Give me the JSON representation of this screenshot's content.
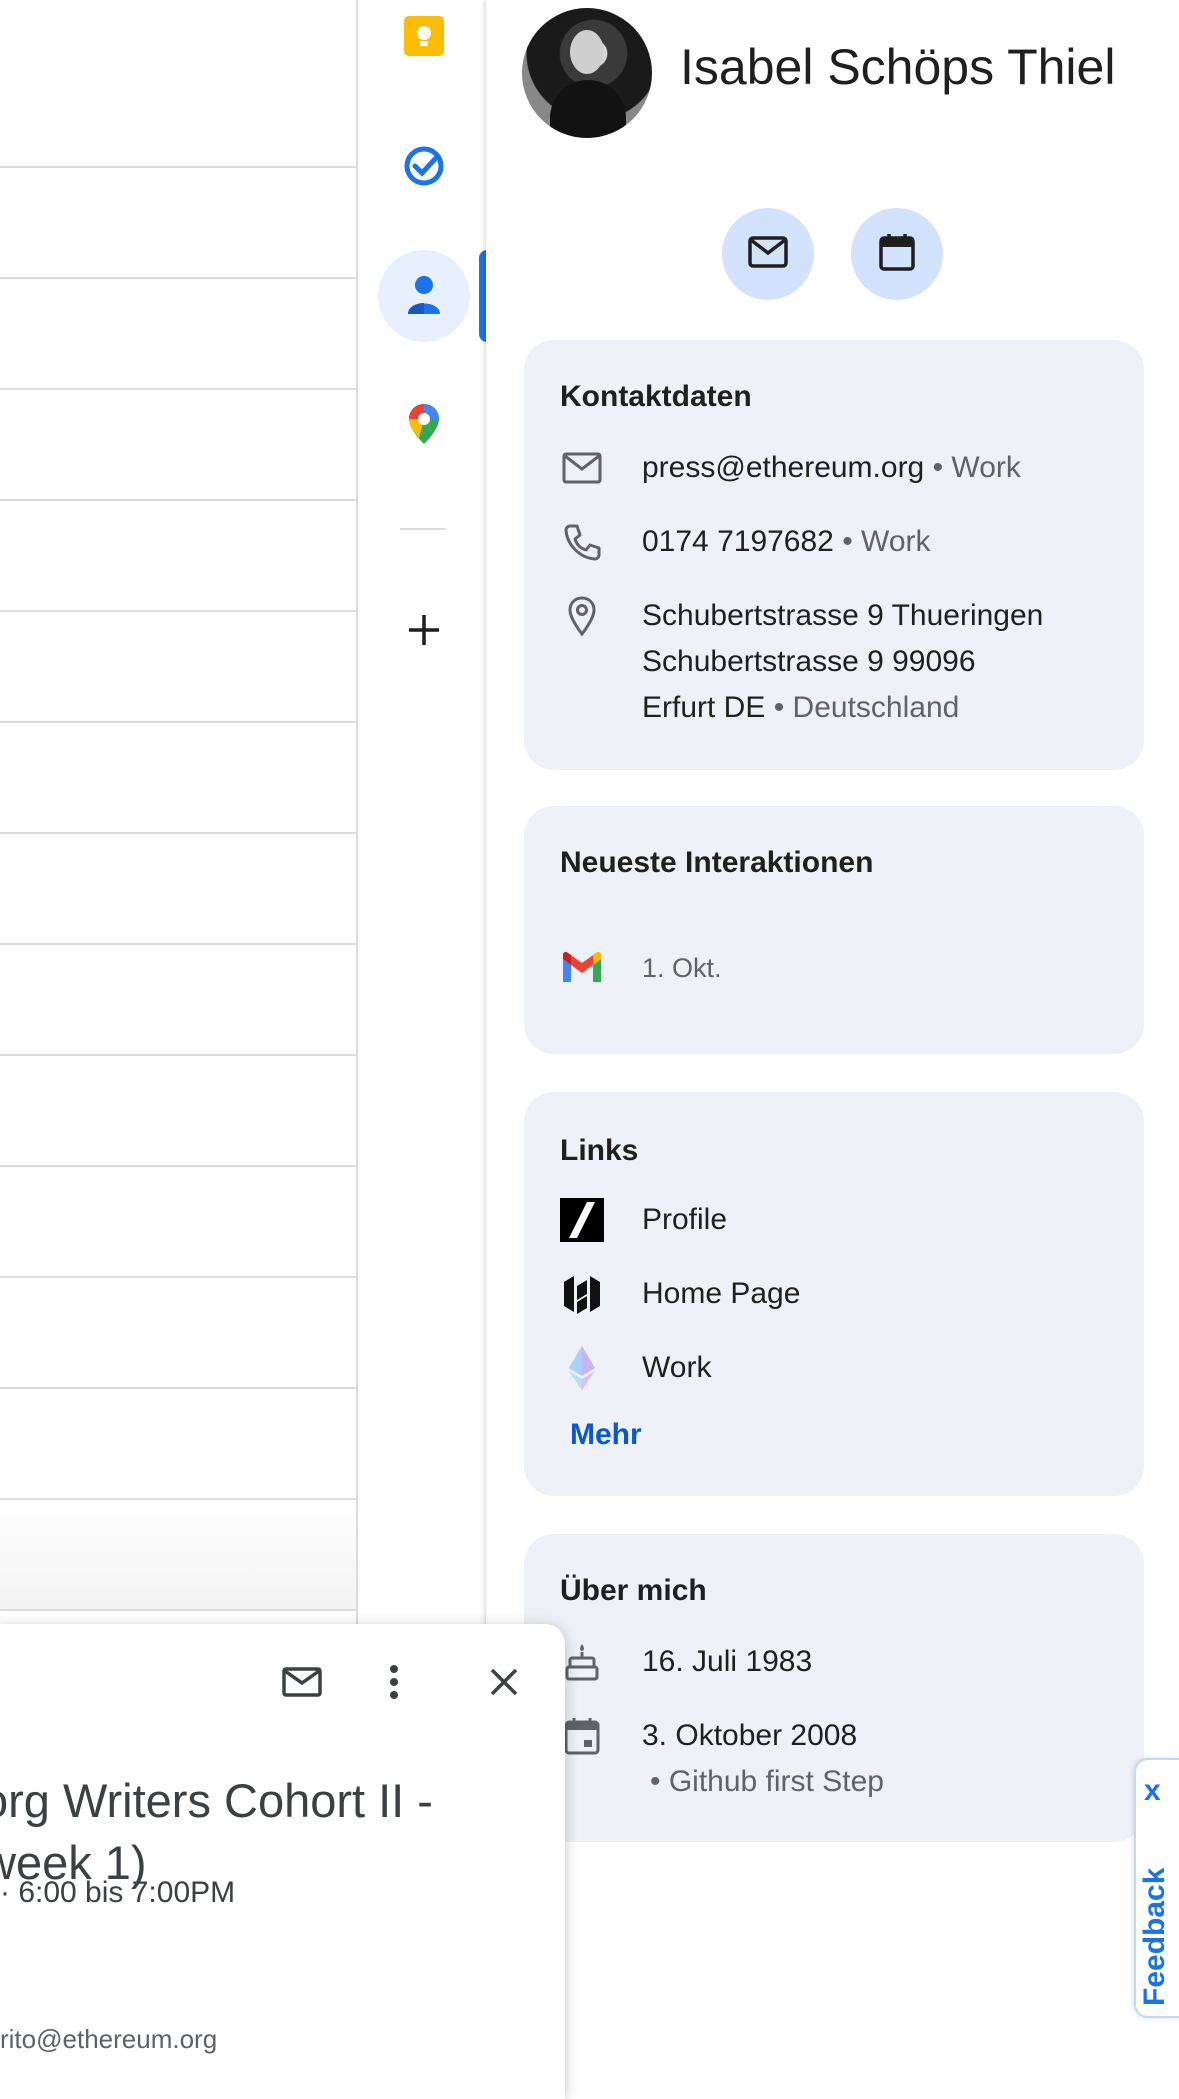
{
  "contact": {
    "name": "Isabel Schöps Thiel"
  },
  "quick_actions": {
    "email_icon": "mail-icon",
    "calendar_icon": "calendar-icon"
  },
  "side_apps": [
    "keep-icon",
    "tasks-icon",
    "contacts-icon",
    "maps-icon",
    "add-icon"
  ],
  "contact_details": {
    "title": "Kontaktdaten",
    "email": {
      "value": "press@ethereum.org",
      "type": "• Work"
    },
    "phone": {
      "value": "0174 7197682",
      "type": "• Work"
    },
    "address": {
      "line1": "Schubertstrasse 9 Thueringen",
      "line2": "Schubertstrasse 9 99096",
      "line3": "Erfurt DE",
      "country": "• Deutschland"
    }
  },
  "interactions": {
    "title": "Neueste Interaktionen",
    "items": [
      {
        "icon": "gmail-icon",
        "date": "1. Okt."
      }
    ]
  },
  "links": {
    "title": "Links",
    "items": [
      {
        "icon": "profile-logo-icon",
        "label": "Profile"
      },
      {
        "icon": "homepage-logo-icon",
        "label": "Home Page"
      },
      {
        "icon": "ethereum-icon",
        "label": "Work"
      }
    ],
    "more": "Mehr"
  },
  "about": {
    "title": "Über mich",
    "birthday": "16. Juli 1983",
    "event_date": "3. Oktober 2008",
    "event_label": "• Github first Step"
  },
  "feedback": {
    "label": "Feedback",
    "close": "x"
  },
  "event_popup": {
    "title_line1": "org Writers Cohort II -",
    "title_line2": "week 1)",
    "time": "·   6:00 bis 7:00PM",
    "email": "rito@ethereum.org"
  },
  "colors": {
    "accent": "#1a73e8",
    "link": "#0b57d0",
    "card_bg": "#eef1f7",
    "quick_btn_bg": "#d3e3fd"
  }
}
